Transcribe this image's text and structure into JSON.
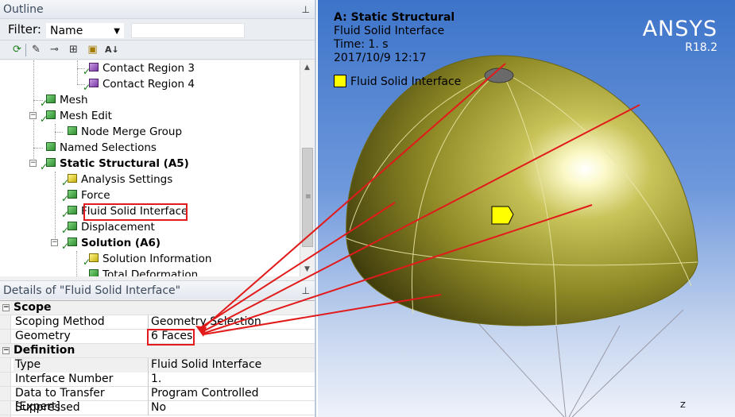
{
  "outline": {
    "title": "Outline",
    "filter_label": "Filter:",
    "filter_value": "Name",
    "tree": [
      {
        "label": "Contact Region 3"
      },
      {
        "label": "Contact Region 4"
      },
      {
        "label": "Mesh"
      },
      {
        "label": "Mesh Edit"
      },
      {
        "label": "Node Merge Group"
      },
      {
        "label": "Named Selections"
      },
      {
        "label": "Static Structural (A5)"
      },
      {
        "label": "Analysis Settings"
      },
      {
        "label": "Force"
      },
      {
        "label": "Fluid Solid Interface"
      },
      {
        "label": "Displacement"
      },
      {
        "label": "Solution (A6)"
      },
      {
        "label": "Solution Information"
      },
      {
        "label": "Total Deformation"
      }
    ]
  },
  "details": {
    "title": "Details of \"Fluid Solid Interface\"",
    "groups": {
      "scope": "Scope",
      "definition": "Definition"
    },
    "rows": [
      {
        "key": "Scoping Method",
        "value": "Geometry Selection"
      },
      {
        "key": "Geometry",
        "value": "6 Faces"
      },
      {
        "key": "Type",
        "value": "Fluid Solid Interface"
      },
      {
        "key": "Interface Number",
        "value": "1."
      },
      {
        "key": "Data to Transfer [Expert]",
        "value": "Program Controlled"
      },
      {
        "key": "Suppressed",
        "value": "No"
      }
    ]
  },
  "viewport": {
    "title": "A: Static Structural",
    "subtitle": "Fluid Solid Interface",
    "time": "Time: 1. s",
    "timestamp": "2017/10/9 12:17",
    "legend_label": "Fluid Solid Interface",
    "legend_color": "#ffff00",
    "brand": "ANSYS",
    "version": "R18.2",
    "axis_label": "Z"
  },
  "colors": {
    "highlight": "#e11b1b",
    "dome": "#c8c24a"
  }
}
